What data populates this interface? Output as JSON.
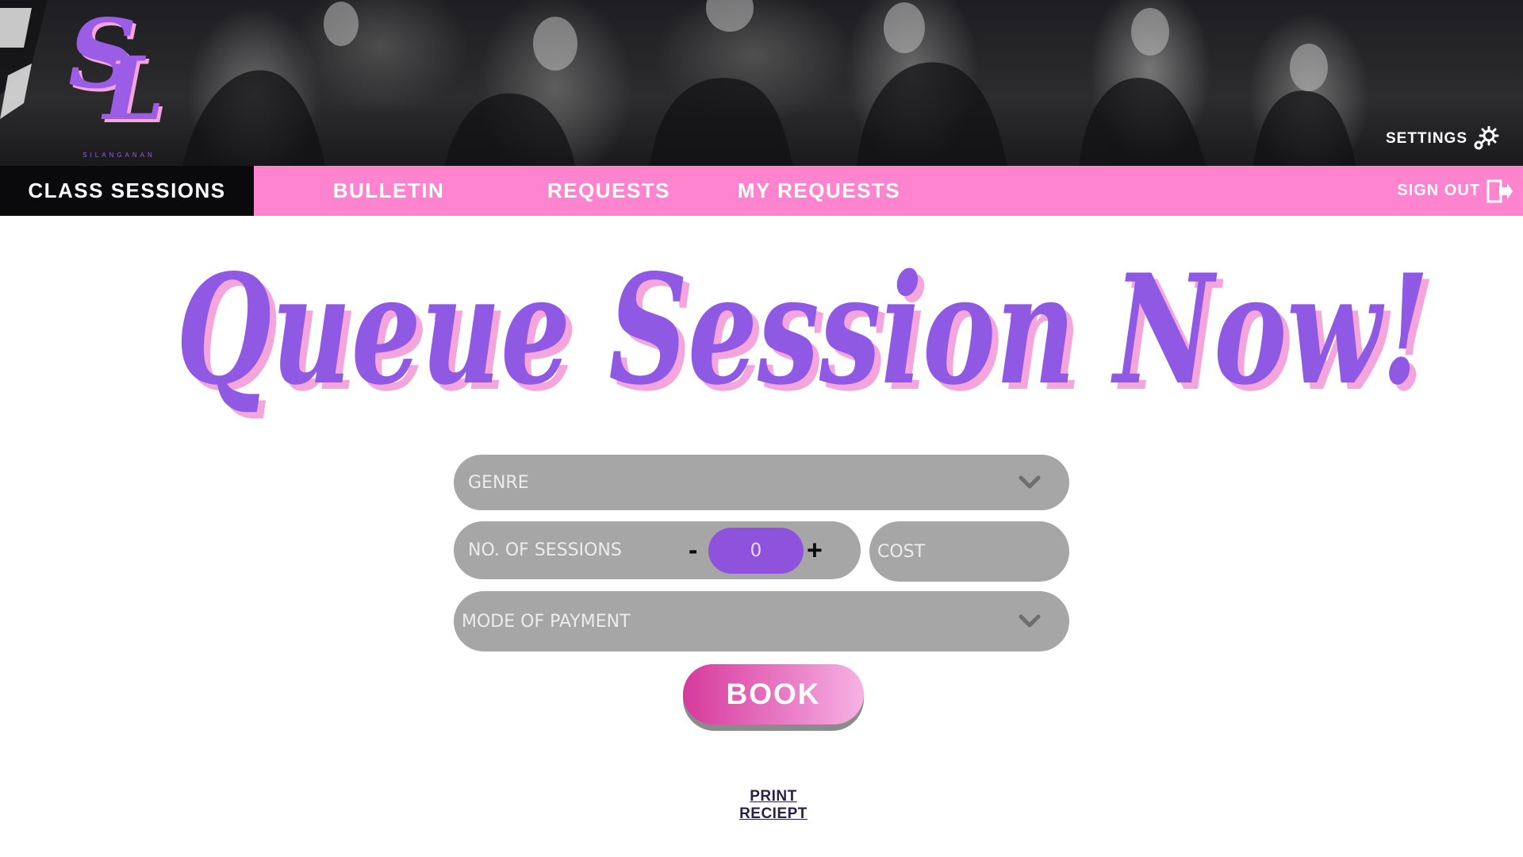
{
  "brand": {
    "logo_text": "SL",
    "logo_sub": "SILANGANAN",
    "accent": "#9b5de5",
    "pink": "#ff84cf"
  },
  "header": {
    "settings_label": "SETTINGS",
    "settings_icon": "gear-icon"
  },
  "nav": {
    "tabs": [
      {
        "label": "CLASS SESSIONS",
        "active": true
      },
      {
        "label": "BULLETIN",
        "active": false
      },
      {
        "label": "REQUESTS",
        "active": false
      },
      {
        "label": "MY REQUESTS",
        "active": false
      }
    ],
    "signout_label": "SIGN OUT",
    "signout_icon": "sign-out-icon"
  },
  "main": {
    "title": "Queue Session Now!",
    "form": {
      "genre_placeholder": "GENRE",
      "sessions_label": "NO. OF SESSIONS",
      "sessions_minus": "-",
      "sessions_plus": "+",
      "sessions_value": "0",
      "cost_placeholder": "COST",
      "payment_placeholder": "MODE OF PAYMENT",
      "book_label": "BOOK",
      "print_label": "PRINT RECIEPT"
    }
  }
}
